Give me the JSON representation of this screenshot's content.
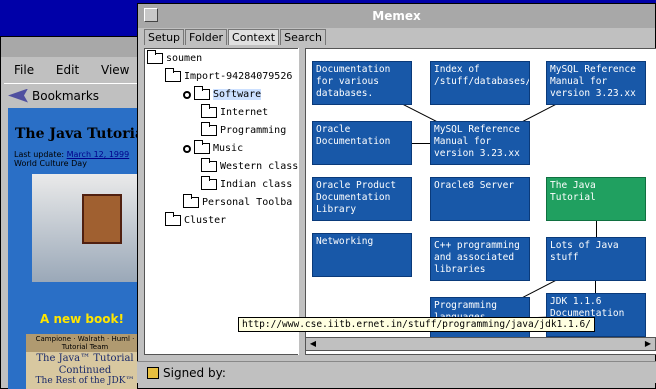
{
  "browser": {
    "menu": [
      "File",
      "Edit",
      "View",
      "G"
    ],
    "bookmarks_label": "Bookmarks",
    "page_title": "The Java Tutorial",
    "last_update_label": "Last update:",
    "last_update_date": "March 12, 1999",
    "culture_day": "World Culture Day",
    "new_book": "A new book!",
    "book_authors": "Campione · Walrath · Huml · Tutorial Team",
    "book_title_1": "The Java™ Tutorial",
    "book_title_2": "Continued",
    "book_subtitle": "The Rest of the JDK™"
  },
  "memex": {
    "title": "Memex",
    "tabs": [
      "Setup",
      "Folder",
      "Context",
      "Search"
    ],
    "active_tab": "Context",
    "tree": [
      {
        "label": "soumen",
        "indent": 0,
        "pin": false,
        "selected": false
      },
      {
        "label": "Import-94284079526",
        "indent": 1,
        "pin": false,
        "selected": false
      },
      {
        "label": "Software",
        "indent": 2,
        "pin": true,
        "selected": true
      },
      {
        "label": "Internet",
        "indent": 3,
        "pin": false,
        "selected": false
      },
      {
        "label": "Programming",
        "indent": 3,
        "pin": false,
        "selected": false
      },
      {
        "label": "Music",
        "indent": 2,
        "pin": true,
        "selected": false
      },
      {
        "label": "Western class",
        "indent": 3,
        "pin": false,
        "selected": false
      },
      {
        "label": "Indian class",
        "indent": 3,
        "pin": false,
        "selected": false
      },
      {
        "label": "Personal Toolba",
        "indent": 2,
        "pin": false,
        "selected": false
      },
      {
        "label": "Cluster",
        "indent": 1,
        "pin": false,
        "selected": false
      }
    ],
    "graph_nodes": [
      {
        "id": "doc",
        "text": "Documentation for various databases.",
        "green": false
      },
      {
        "id": "index",
        "text": "Index of /stuff/databases/LDAP",
        "green": false
      },
      {
        "id": "mysql1",
        "text": "MySQL Reference Manual for version 3.23.xx",
        "green": false
      },
      {
        "id": "oracle",
        "text": "Oracle Documentation",
        "green": false
      },
      {
        "id": "mysql2",
        "text": "MySQL Reference Manual for version 3.23.xx",
        "green": false
      },
      {
        "id": "opdl",
        "text": "Oracle Product Documentation Library",
        "green": false
      },
      {
        "id": "o8",
        "text": "Oracle8 Server",
        "green": false
      },
      {
        "id": "jt",
        "text": "The Java Tutorial",
        "green": true
      },
      {
        "id": "net",
        "text": "Networking",
        "green": false
      },
      {
        "id": "cpp",
        "text": "C++ programming and associated libraries",
        "green": false
      },
      {
        "id": "lots",
        "text": "Lots of Java stuff",
        "green": false
      },
      {
        "id": "pl",
        "text": "Programming languages.",
        "green": false
      },
      {
        "id": "jdk",
        "text": "JDK 1.1.6 Documentation",
        "green": false
      }
    ],
    "tooltip": "http://www.cse.iitb.ernet.in/stuff/programming/java/jdk1.1.6/",
    "status": "Signed by:"
  }
}
